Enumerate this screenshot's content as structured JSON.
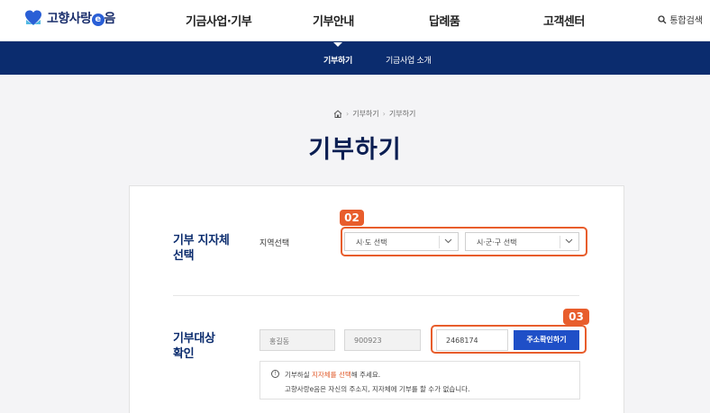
{
  "header": {
    "logo_text": "고향사랑",
    "logo_e": "e",
    "logo_suffix": "음",
    "nav": [
      "기금사업·기부",
      "기부안내",
      "답례품",
      "고객센터"
    ],
    "search_label": "통합검색"
  },
  "subnav": {
    "items": [
      "기부하기",
      "기금사업 소개"
    ],
    "active_index": 0
  },
  "breadcrumb": [
    "기부하기",
    "기부하기"
  ],
  "page_title": "기부하기",
  "region_section": {
    "title_line1": "기부 지자체",
    "title_line2": "선택",
    "field_label": "지역선택",
    "select_sido": "시·도 선택",
    "select_sigungu": "시·군·구 선택"
  },
  "confirm_section": {
    "title_line1": "기부대상",
    "title_line2": "확인",
    "name_value": "홍길동",
    "birth_value": "900923",
    "zip_value": "2468174",
    "address_button": "주소확인하기"
  },
  "notice": {
    "line1_pre": "기부하실 ",
    "line1_hl": "지자체를 선택",
    "line1_post": "해 주세요.",
    "line2": "고향사랑e음은 자신의 주소지, 지자체에 기부를 할 수가 없습니다."
  },
  "highlights": {
    "badge_region": "02",
    "badge_confirm": "03"
  },
  "colors": {
    "brand_navy": "#0b2c6e",
    "primary_button": "#1f4fc7",
    "highlight": "#e85d2c"
  }
}
